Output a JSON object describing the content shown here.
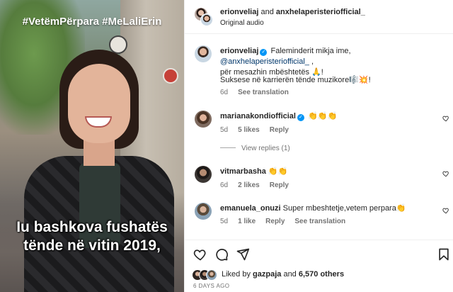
{
  "media": {
    "hashtags": "#VetëmPërpara #MeLaliErin",
    "subtitle_line1": "Iu bashkova fushatës",
    "subtitle_line2": "tënde në vitin 2019,"
  },
  "header": {
    "user1": "erionveliaj",
    "joiner": " and ",
    "user2": "anxhelaperisteriofficial_",
    "audio": "Original audio",
    "more_icon": "more-horizontal-icon"
  },
  "caption": {
    "username": "erionveliaj",
    "text_a": "Faleminderit mikja ime, ",
    "mention": "@anxhelaperisteriofficial_",
    "text_b": " ,",
    "text_c": "për mesazhin mbështetës 🙏!",
    "text_d": "Suksese në karrierën tënde muzikore🎼💥!",
    "age": "6d",
    "see_translation": "See translation"
  },
  "comments": [
    {
      "username": "marianakondiofficial",
      "verified": true,
      "text": "👏👏👏",
      "age": "5d",
      "likes": "5 likes",
      "reply": "Reply",
      "view_replies": "View replies (1)"
    },
    {
      "username": "vitmarbasha",
      "verified": false,
      "text": "👏👏",
      "age": "6d",
      "likes": "2 likes",
      "reply": "Reply"
    },
    {
      "username": "emanuela_onuzi",
      "verified": false,
      "text": "Super mbeshtetje,vetem perpara👏",
      "age": "5d",
      "likes": "1 like",
      "reply": "Reply",
      "see_translation": "See translation"
    }
  ],
  "footer": {
    "liked_by": "Liked by ",
    "liker": "gazpaja",
    "and": " and ",
    "others": "6,570 others",
    "timestamp": "6 DAYS AGO"
  },
  "icons": [
    "heart-icon",
    "comment-icon",
    "share-icon",
    "bookmark-icon",
    "verified-badge-icon"
  ],
  "colors": {
    "verified": "#0095f6",
    "mention": "#00376b",
    "muted": "#737373"
  }
}
